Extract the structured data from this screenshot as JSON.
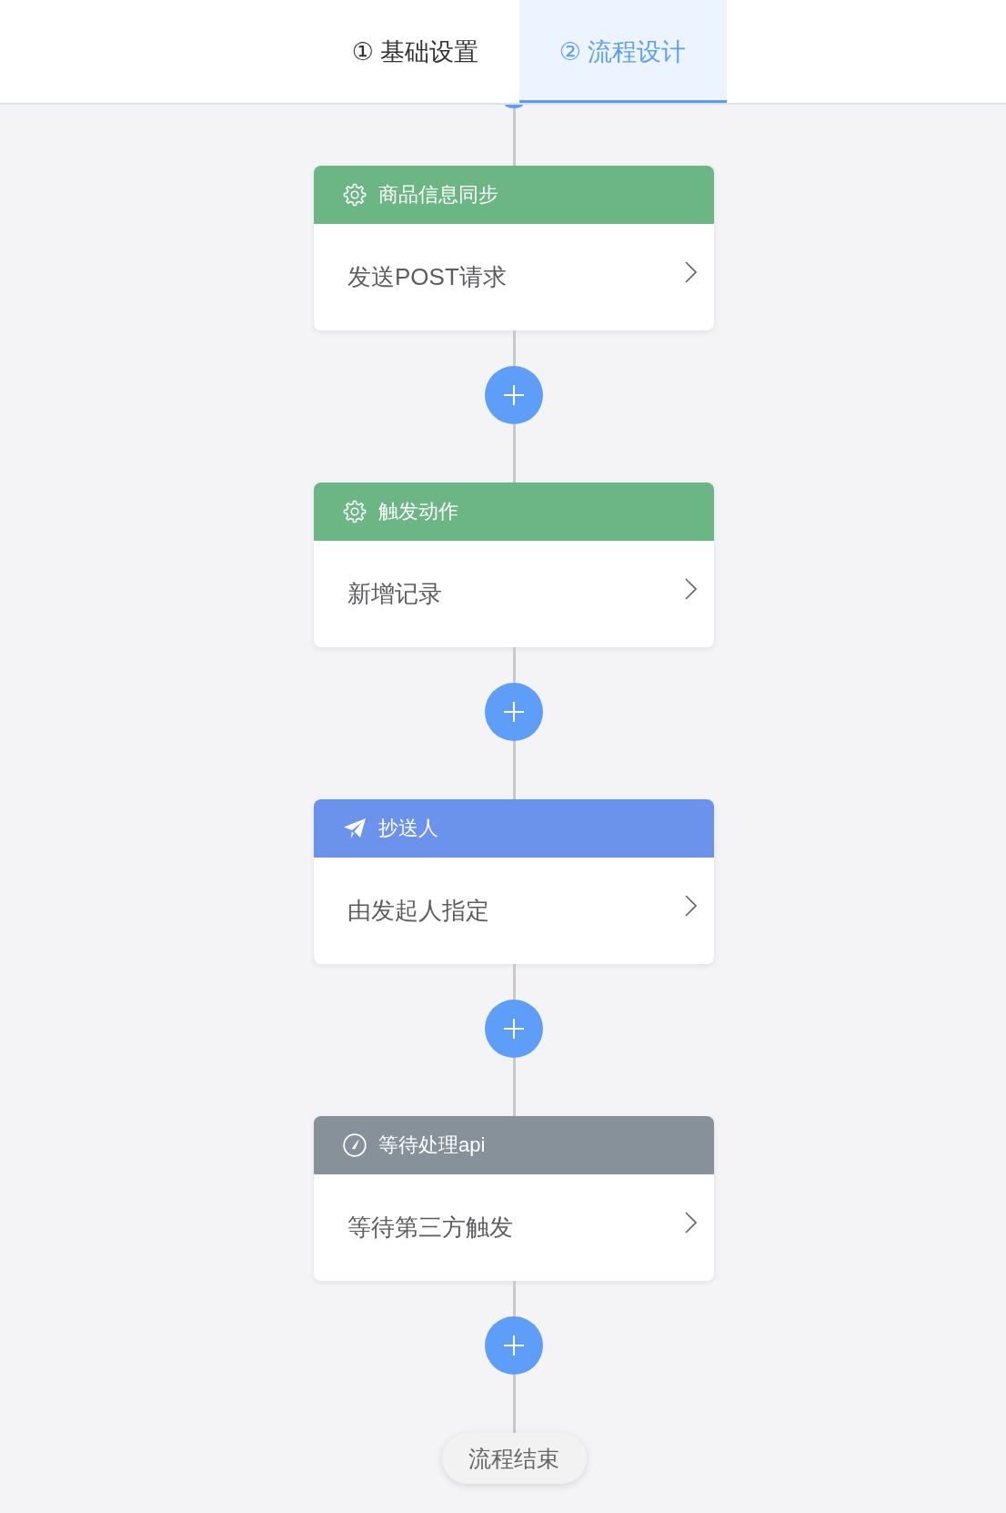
{
  "tabs": [
    {
      "label": "① 基础设置",
      "selected": false
    },
    {
      "label": "② 流程设计",
      "selected": true
    }
  ],
  "nodes": [
    {
      "kind": "action",
      "title": "商品信息同步",
      "description": "发送POST请求",
      "color": "#6bb684"
    },
    {
      "kind": "action",
      "title": "触发动作",
      "description": "新增记录",
      "color": "#6bb684"
    },
    {
      "kind": "cc",
      "title": "抄送人",
      "description": "由发起人指定",
      "color": "#6b93ec"
    },
    {
      "kind": "wait",
      "title": "等待处理api",
      "description": "等待第三方触发",
      "color": "#86919a"
    }
  ],
  "end": {
    "label": "流程结束"
  }
}
